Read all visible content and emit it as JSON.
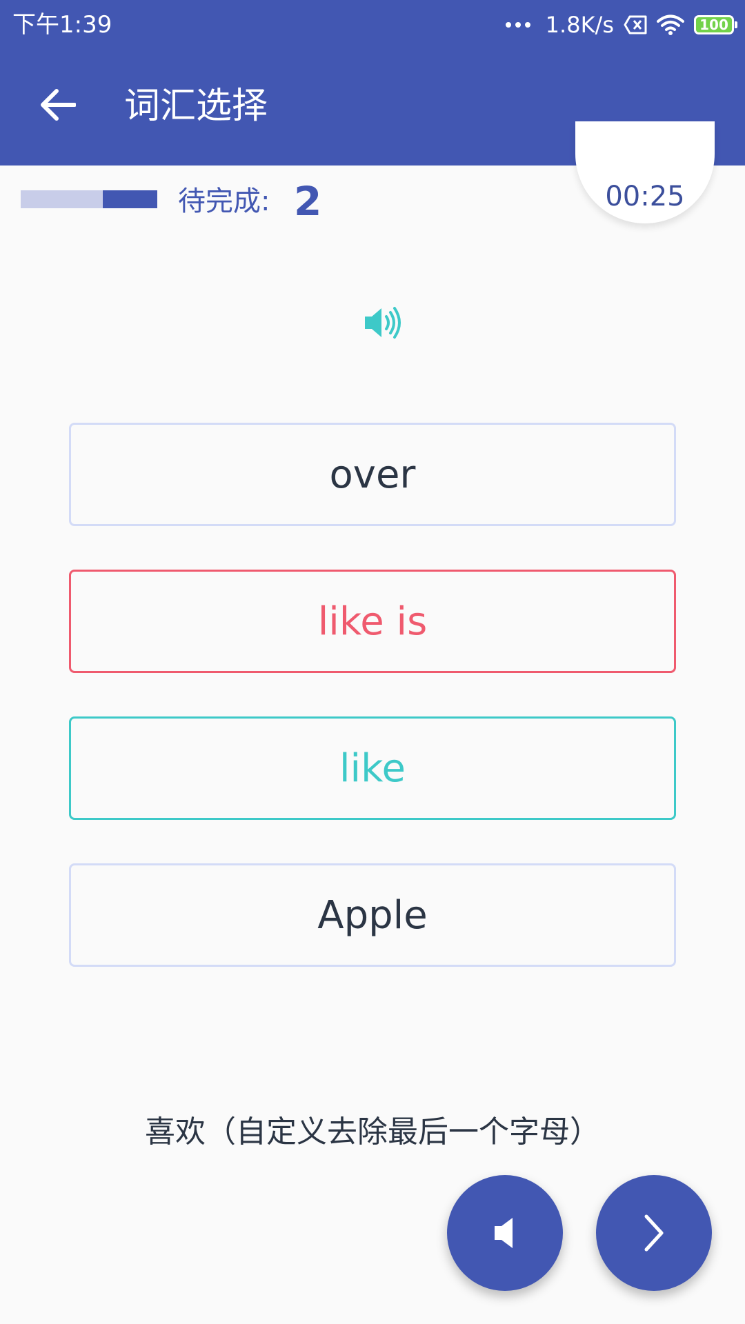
{
  "status_bar": {
    "time": "下午1:39",
    "net_speed": "1.8K/s",
    "battery": "100"
  },
  "app_bar": {
    "title": "词汇选择"
  },
  "progress": {
    "completed_fraction": 0.4,
    "pending_label": "待完成:",
    "pending_count": "2",
    "timer": "00:25"
  },
  "options": [
    {
      "label": "over",
      "state": "default"
    },
    {
      "label": "like is",
      "state": "wrong"
    },
    {
      "label": "like",
      "state": "correct"
    },
    {
      "label": "Apple",
      "state": "default"
    }
  ],
  "meaning": "喜欢（自定义去除最后一个字母）",
  "colors": {
    "primary": "#4257b2",
    "correct": "#3dc9c8",
    "wrong": "#ef5a6e",
    "text": "#2b3544"
  }
}
